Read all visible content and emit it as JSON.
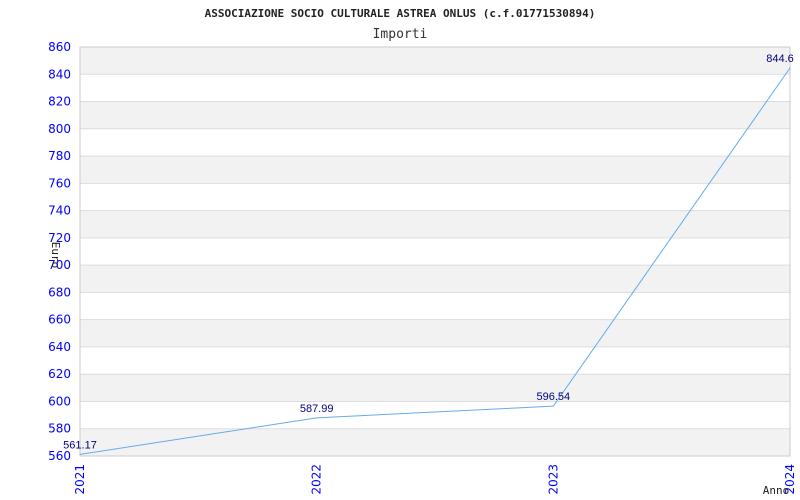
{
  "chart_data": {
    "type": "line",
    "title": "ASSOCIAZIONE SOCIO CULTURALE ASTREA ONLUS (c.f.01771530894)",
    "subtitle": "Importi",
    "xlabel": "Anno",
    "ylabel": "Euro",
    "categories": [
      "2021",
      "2022",
      "2023",
      "2024"
    ],
    "values": [
      561.17,
      587.99,
      596.54,
      844.6
    ],
    "data_labels": [
      "561.17",
      "587.99",
      "596.54",
      "844.6"
    ],
    "ylim": [
      560,
      860
    ],
    "yticks": [
      "560",
      "580",
      "600",
      "620",
      "640",
      "660",
      "680",
      "700",
      "720",
      "740",
      "760",
      "780",
      "800",
      "820",
      "840",
      "860"
    ],
    "grid": true,
    "colors": {
      "line": "#66aaee",
      "tick_labels": "#0000ff",
      "data_labels": "#000080",
      "band": "#f2f2f2",
      "grid": "#dddddd"
    }
  }
}
